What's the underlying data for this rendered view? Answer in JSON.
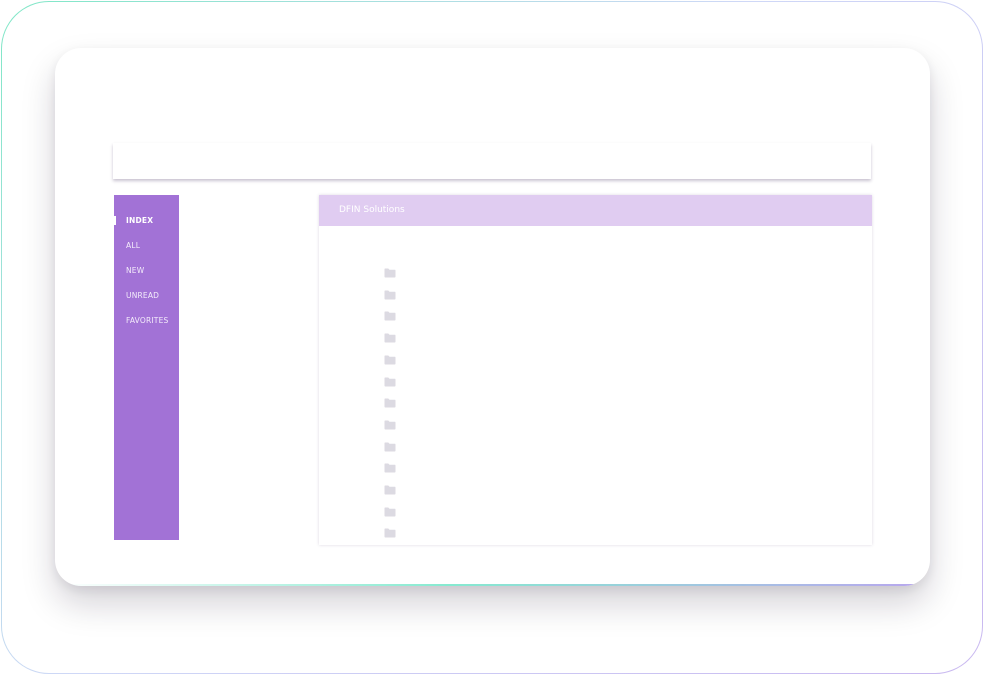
{
  "sidebar": {
    "items": [
      {
        "label": "INDEX",
        "active": true
      },
      {
        "label": "ALL",
        "active": false
      },
      {
        "label": "NEW",
        "active": false
      },
      {
        "label": "UNREAD",
        "active": false
      },
      {
        "label": "FAVORITES",
        "active": false
      }
    ]
  },
  "panel": {
    "title": "DFIN Solutions",
    "folders": [
      {
        "icon": "folder-icon"
      },
      {
        "icon": "folder-icon"
      },
      {
        "icon": "folder-icon"
      },
      {
        "icon": "folder-icon"
      },
      {
        "icon": "folder-icon"
      },
      {
        "icon": "folder-icon"
      },
      {
        "icon": "folder-icon"
      },
      {
        "icon": "folder-icon"
      },
      {
        "icon": "folder-icon"
      },
      {
        "icon": "folder-icon"
      },
      {
        "icon": "folder-icon"
      },
      {
        "icon": "folder-icon"
      },
      {
        "icon": "folder-icon"
      }
    ]
  },
  "colors": {
    "sidebar_bg": "#a272d6",
    "panel_header_bg": "#e0ccf1",
    "folder_icon": "#dcdae2"
  }
}
